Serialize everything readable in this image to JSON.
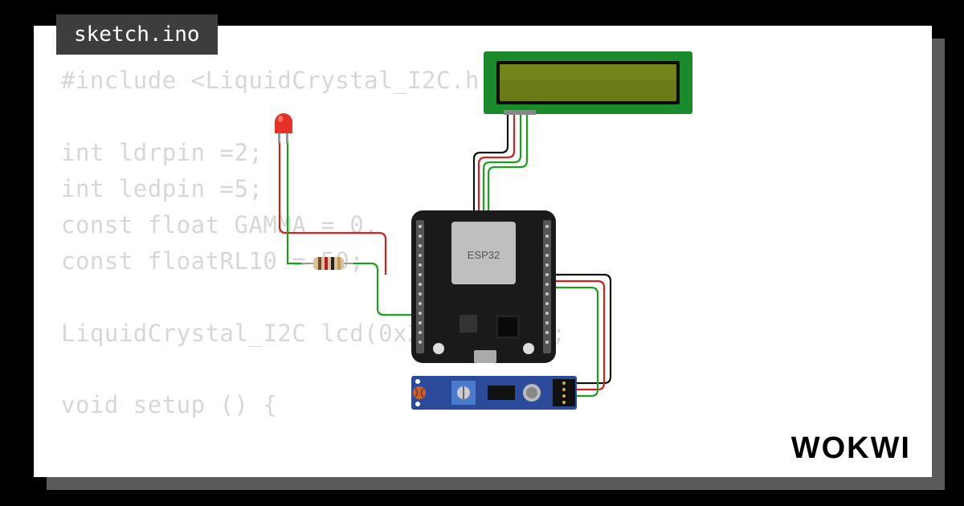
{
  "tab": {
    "filename": "sketch.ino"
  },
  "code": {
    "lines": [
      "#include <LiquidCrystal_I2C.h",
      "",
      "int ldrpin =2;",
      "int ledpin =5;",
      "const float GAMMA = 0.",
      "const floatRL10 = 50;",
      "",
      "LiquidCrystal_I2C lcd(0x27, 16, 2);",
      "",
      "void setup () {"
    ]
  },
  "components": {
    "led": {
      "color": "#e63226"
    },
    "resistor": {
      "bands": [
        "#c09a5b",
        "#6e4a2a",
        "#b52020",
        "#c09a5b"
      ]
    },
    "mcu": {
      "label": "ESP32"
    },
    "lcd": {
      "frame": "#1a8a2a",
      "screen": "#6b7a14"
    },
    "sensor_module": {
      "board": "#2b4a9a"
    }
  },
  "wires": {
    "colors": {
      "red": "#d22020",
      "green": "#1aa01a",
      "black": "#111111"
    }
  },
  "brand": "WOKWI"
}
